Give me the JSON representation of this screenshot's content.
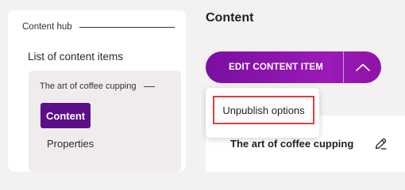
{
  "sidebar": {
    "hub_title": "Content hub",
    "list_link": "List of content items",
    "item_title": "The art of coffee cupping",
    "nav": {
      "content": "Content",
      "properties": "Properties"
    }
  },
  "main": {
    "page_title": "Content",
    "edit_button_label": "EDIT CONTENT ITEM",
    "toggle_icon": "chevron-up-icon",
    "dropdown": {
      "items": [
        "Unpublish options"
      ]
    },
    "card": {
      "title": "The art of coffee cupping",
      "edit_icon": "pencil-icon"
    }
  },
  "colors": {
    "accent": "#5b108a",
    "button_gradient_start": "#7a0ea2",
    "button_gradient_end": "#9b1ab8",
    "highlight_border": "#e23c3c"
  }
}
